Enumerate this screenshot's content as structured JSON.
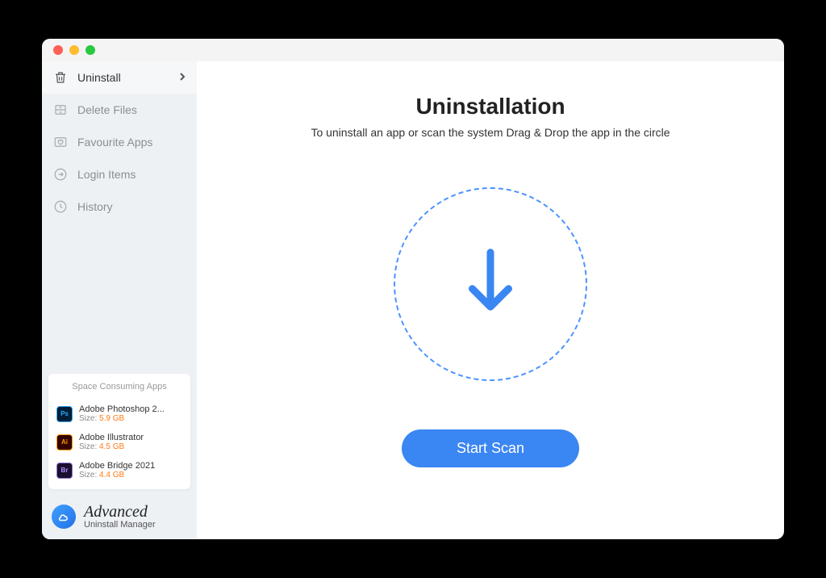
{
  "sidebar": {
    "items": [
      {
        "label": "Uninstall",
        "icon": "trash-icon",
        "active": true
      },
      {
        "label": "Delete Files",
        "icon": "drawer-icon",
        "active": false
      },
      {
        "label": "Favourite Apps",
        "icon": "heart-box-icon",
        "active": false
      },
      {
        "label": "Login Items",
        "icon": "login-icon",
        "active": false
      },
      {
        "label": "History",
        "icon": "clock-icon",
        "active": false
      }
    ]
  },
  "space_card": {
    "title": "Space Consuming Apps",
    "size_label": "Size:",
    "apps": [
      {
        "name": "Adobe Photoshop 2...",
        "size": "5.9 GB",
        "icon_text": "Ps",
        "icon_class": "ps"
      },
      {
        "name": "Adobe Illustrator",
        "size": "4.5 GB",
        "icon_text": "Ai",
        "icon_class": "ai"
      },
      {
        "name": "Adobe Bridge 2021",
        "size": "4.4 GB",
        "icon_text": "Br",
        "icon_class": "br"
      }
    ]
  },
  "brand": {
    "line1": "Advanced",
    "line2": "Uninstall Manager"
  },
  "main": {
    "title": "Uninstallation",
    "subtitle": "To uninstall an app or scan the system Drag & Drop the app in the circle",
    "scan_button": "Start Scan"
  }
}
